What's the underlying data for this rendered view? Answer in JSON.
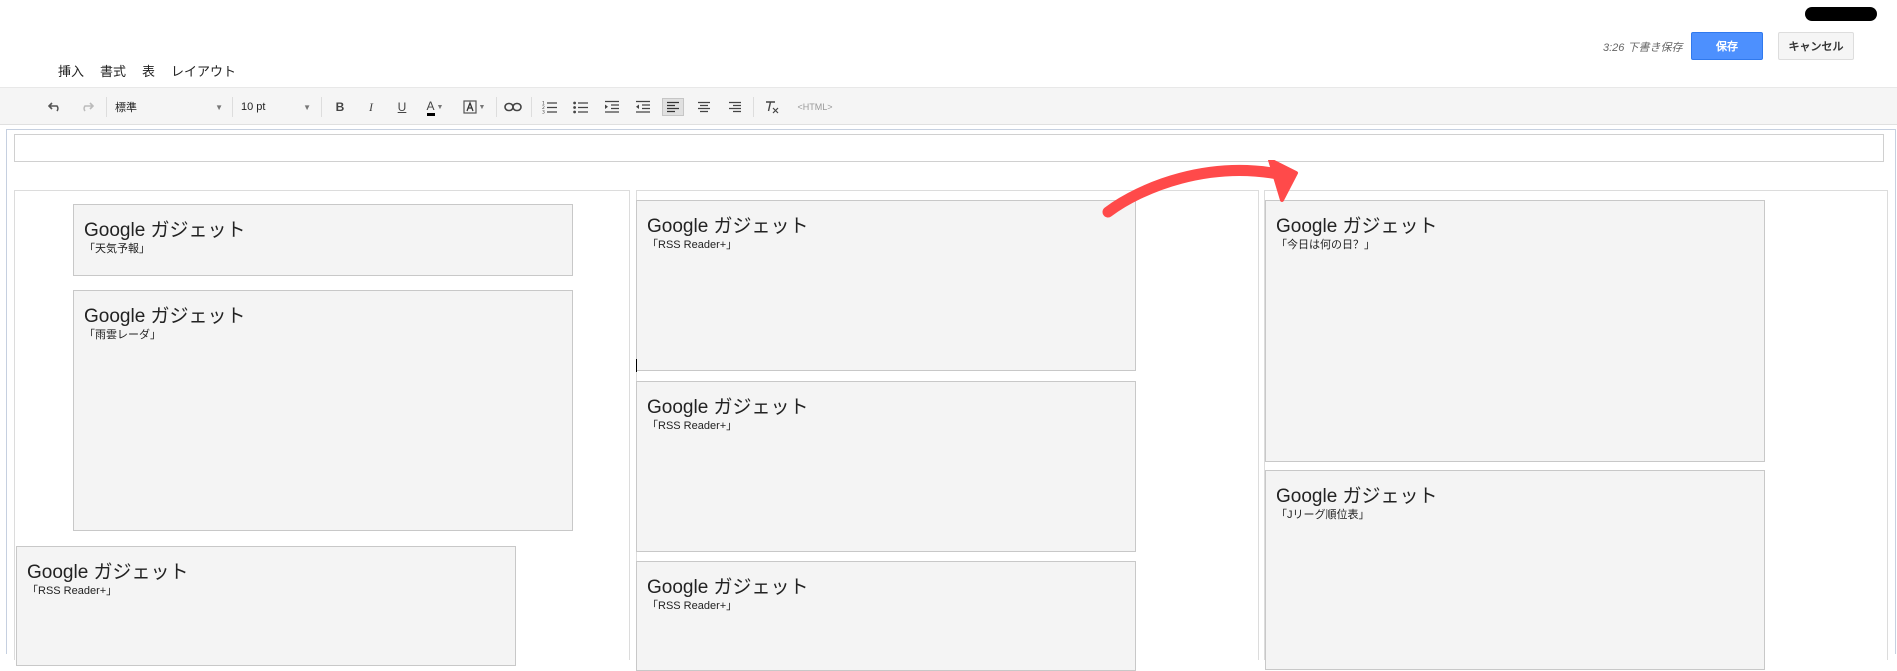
{
  "header": {
    "save_status": "3:26 下書き保存",
    "save_label": "保存",
    "cancel_label": "キャンセル"
  },
  "menu": {
    "items": [
      "挿入",
      "書式",
      "表",
      "レイアウト"
    ]
  },
  "toolbar": {
    "paragraph_style": "標準",
    "font_size": "10 pt",
    "bold": "B",
    "italic": "I",
    "underline": "U",
    "text_color": "A",
    "html_label": "<HTML>"
  },
  "gadgets": [
    {
      "title": "Google ガジェット",
      "subtitle": "「天気予報」"
    },
    {
      "title": "Google ガジェット",
      "subtitle": "「雨雲レーダ」"
    },
    {
      "title": "Google ガジェット",
      "subtitle": "「RSS Reader+」"
    },
    {
      "title": "Google ガジェット",
      "subtitle": "「RSS Reader+」"
    },
    {
      "title": "Google ガジェット",
      "subtitle": "「RSS Reader+」"
    },
    {
      "title": "Google ガジェット",
      "subtitle": "「RSS Reader+」"
    },
    {
      "title": "Google ガジェット",
      "subtitle": "「今日は何の日？」"
    },
    {
      "title": "Google ガジェット",
      "subtitle": "「Jリーグ順位表」"
    }
  ],
  "colors": {
    "accent": "#4d90fe",
    "annotation_arrow": "#ff4a4a"
  }
}
